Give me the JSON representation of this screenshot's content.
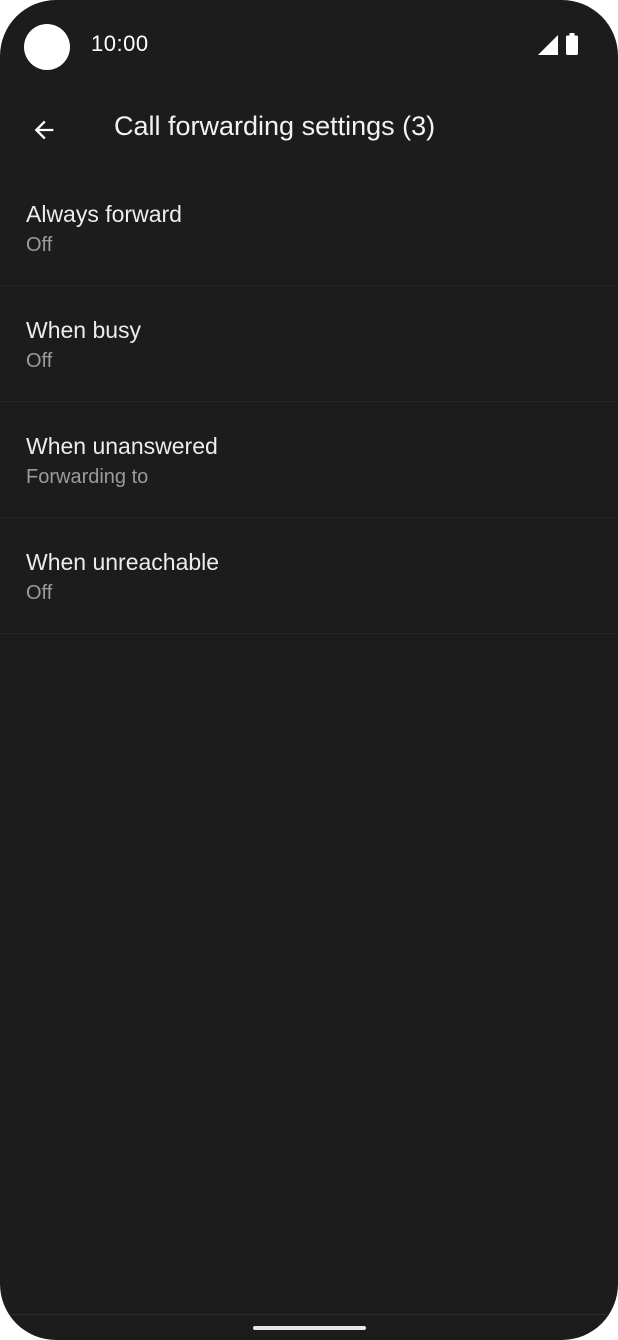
{
  "status_bar": {
    "time": "10:00",
    "icons": [
      "camera-cutout",
      "cell-signal-icon",
      "battery-icon"
    ]
  },
  "app_bar": {
    "back_icon": "arrow-back-icon",
    "title": "Call forwarding settings (3)"
  },
  "settings": {
    "items": [
      {
        "title": "Always forward",
        "summary": "Off"
      },
      {
        "title": "When busy",
        "summary": "Off"
      },
      {
        "title": "When unanswered",
        "summary": "Forwarding to"
      },
      {
        "title": "When unreachable",
        "summary": "Off"
      }
    ]
  },
  "colors": {
    "background": "#1c1c1c",
    "primary_text": "#ececec",
    "secondary_text": "#9b9b9b"
  }
}
